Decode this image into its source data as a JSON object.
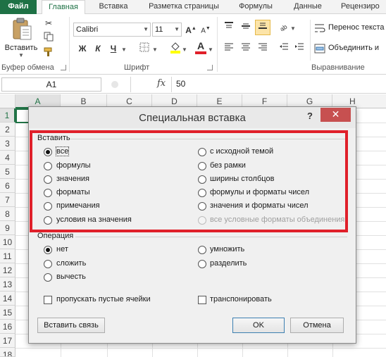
{
  "ribbon_tabs": [
    "Файл",
    "Главная",
    "Вставка",
    "Разметка страницы",
    "Формулы",
    "Данные",
    "Рецензиро"
  ],
  "clipboard": {
    "paste_label": "Вставить",
    "group_label": "Буфер обмена"
  },
  "font": {
    "name": "Calibri",
    "size": "11",
    "bold": "Ж",
    "italic": "К",
    "underline": "Ч",
    "group_label": "Шрифт"
  },
  "alignment": {
    "wrap_text": "Перенос текста",
    "merge": "Объединить и",
    "group_label": "Выравнивание"
  },
  "formula_bar": {
    "cell_ref": "A1",
    "fx": "fx",
    "value": "50"
  },
  "columns": [
    "A",
    "B",
    "C",
    "D",
    "E",
    "F",
    "G",
    "H"
  ],
  "rows": [
    "1",
    "2",
    "3",
    "4",
    "5",
    "6",
    "7",
    "8",
    "9",
    "10",
    "11",
    "12",
    "13",
    "14",
    "15",
    "16",
    "17",
    "18"
  ],
  "dialog": {
    "title": "Специальная вставка",
    "help": "?",
    "close": "✕",
    "paste_section": "Вставить",
    "paste_options_left": [
      "все",
      "формулы",
      "значения",
      "форматы",
      "примечания",
      "условия на значения"
    ],
    "paste_options_right": [
      "с исходной темой",
      "без рамки",
      "ширины столбцов",
      "формулы и форматы чисел",
      "значения и форматы чисел",
      "все условные форматы объединения"
    ],
    "operation_section": "Операция",
    "operation_left": [
      "нет",
      "сложить",
      "вычесть"
    ],
    "operation_right": [
      "умножить",
      "разделить"
    ],
    "skip_blanks": "пропускать пустые ячейки",
    "transpose": "транспонировать",
    "paste_link": "Вставить связь",
    "ok": "OK",
    "cancel": "Отмена"
  },
  "colors": {
    "excel_green": "#1e7145",
    "highlight_red": "#e0202a",
    "close_red": "#c75050"
  }
}
